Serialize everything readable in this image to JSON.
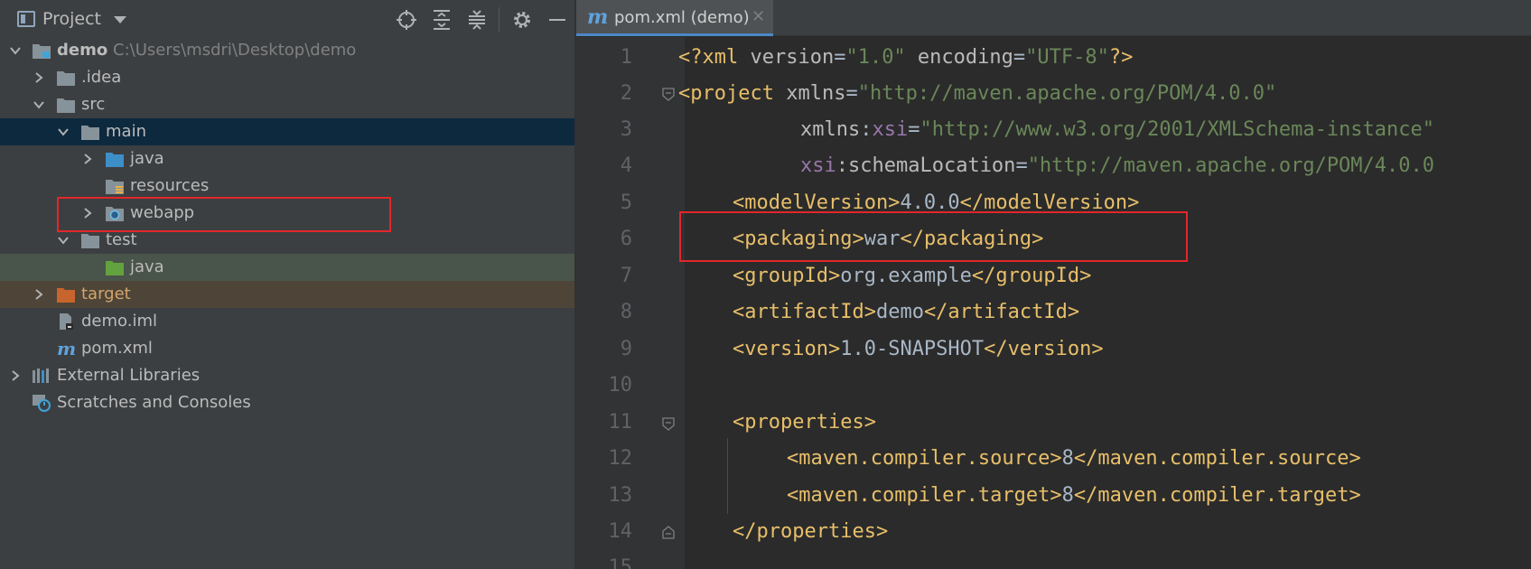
{
  "project_panel": {
    "title": "Project",
    "tree": {
      "root_name": "demo",
      "root_path": "C:\\Users\\msdri\\Desktop\\demo",
      "idea": ".idea",
      "src": "src",
      "main": "main",
      "java_main": "java",
      "resources": "resources",
      "webapp": "webapp",
      "test": "test",
      "java_test": "java",
      "target": "target",
      "demo_iml": "demo.iml",
      "pom_xml": "pom.xml",
      "external_libraries": "External Libraries",
      "scratches": "Scratches and Consoles"
    }
  },
  "editor": {
    "tab_label": "pom.xml (demo)",
    "tab_icon": "m",
    "line_numbers": [
      "1",
      "2",
      "3",
      "4",
      "5",
      "6",
      "7",
      "8",
      "9",
      "10",
      "11",
      "12",
      "13",
      "14",
      "15"
    ],
    "code": {
      "l1_a": "<?xml ",
      "l1_b": "version",
      "l1_c": "=",
      "l1_d": "\"1.0\"",
      "l1_e": " encoding",
      "l1_f": "=",
      "l1_g": "\"UTF-8\"",
      "l1_h": "?>",
      "l2_a": "<project ",
      "l2_b": "xmlns",
      "l2_c": "=",
      "l2_d": "\"http://maven.apache.org/POM/4.0.0\"",
      "l3_a": "xmlns",
      "l3_b": ":",
      "l3_c": "xsi",
      "l3_d": "=",
      "l3_e": "\"http://www.w3.org/2001/XMLSchema-instance\"",
      "l4_a": "xsi",
      "l4_b": ":schemaLocation",
      "l4_c": "=",
      "l4_d": "\"http://maven.apache.org/POM/4.0.0",
      "l5_open": "<modelVersion>",
      "l5_val": "4.0.0",
      "l5_close": "</modelVersion>",
      "l6_open": "<packaging>",
      "l6_val": "war",
      "l6_close": "</packaging>",
      "l7_open": "<groupId>",
      "l7_val": "org.example",
      "l7_close": "</groupId>",
      "l8_open": "<artifactId>",
      "l8_val": "demo",
      "l8_close": "</artifactId>",
      "l9_open": "<version>",
      "l9_val": "1.0-SNAPSHOT",
      "l9_close": "</version>",
      "l11": "<properties>",
      "l12_open": "<maven.compiler.source>",
      "l12_val": "8",
      "l12_close": "</maven.compiler.source>",
      "l13_open": "<maven.compiler.target>",
      "l13_val": "8",
      "l13_close": "</maven.compiler.target>",
      "l14": "</properties>"
    }
  },
  "colors": {
    "tag": "#e8bf6a",
    "attribute": "#bababa",
    "string": "#6a8759",
    "namespace": "#9876aa",
    "text": "#a9b7c6",
    "highlight_box": "#e3262a",
    "selection": "#0d293e"
  },
  "icons": {
    "locate": "crosshair-icon",
    "expand": "expand-all-icon",
    "collapse": "collapse-all-icon",
    "settings": "gear-icon",
    "hide": "minimize-icon"
  }
}
